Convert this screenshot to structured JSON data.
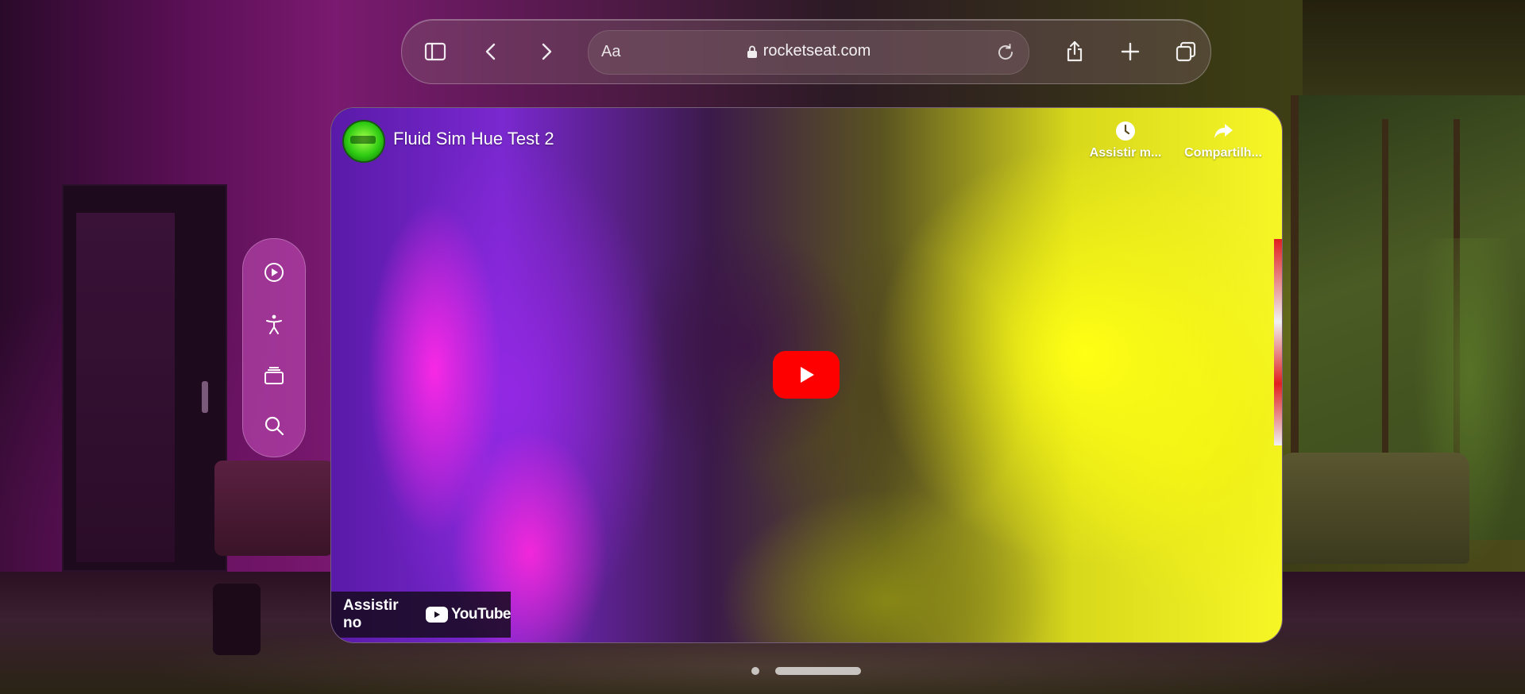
{
  "browser": {
    "address_bar": {
      "reader_label": "Aa",
      "url": "rocketseat.com"
    }
  },
  "video": {
    "title": "Fluid Sim Hue Test 2",
    "actions": [
      {
        "label": "Assistir m...",
        "icon": "clock-icon"
      },
      {
        "label": "Compartilh...",
        "icon": "share-arrow-icon"
      }
    ],
    "watch_on_label": "Assistir no",
    "youtube_wordmark": "YouTube",
    "colors": {
      "play_button": "#ff0000",
      "magenta": "#ff28e6",
      "violet": "#7a28d0",
      "yellow": "#f6f626"
    }
  },
  "sidebar": {
    "icons": [
      "play-circle-icon",
      "accessibility-icon",
      "stack-icon",
      "search-icon"
    ]
  },
  "toolbar_icons": [
    "sidebar-toggle-icon",
    "chevron-left-icon",
    "chevron-right-icon",
    "lock-icon",
    "reload-icon",
    "share-icon",
    "plus-icon",
    "tabs-icon"
  ]
}
